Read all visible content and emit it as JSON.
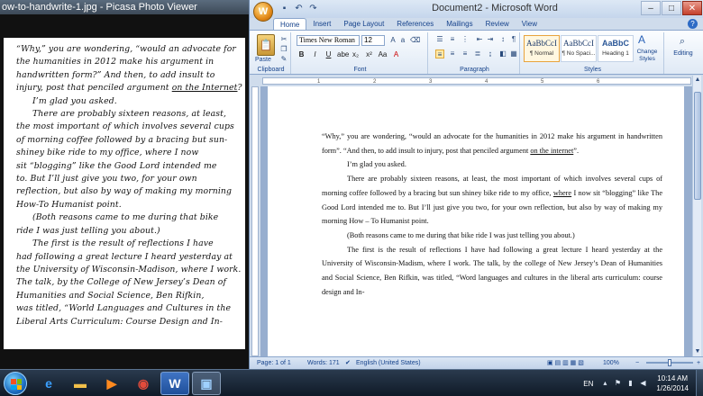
{
  "picasa": {
    "title": "ow-to-handwrite-1.jpg - Picasa Photo Viewer",
    "handwriting": [
      {
        "text": "“Why,” you are wondering, “would an advocate for",
        "indent": false
      },
      {
        "text": "the humanities in 2012 make his argument in",
        "indent": false
      },
      {
        "text": "handwritten form?” And then, to add insult to",
        "indent": false
      },
      {
        "text": "injury, post that penciled argument on the Internet?",
        "indent": false,
        "underline": "on the Internet"
      },
      {
        "text": "I’m glad you asked.",
        "indent": true
      },
      {
        "text": "There are probably sixteen reasons, at least,",
        "indent": true
      },
      {
        "text": "the most important of which involves several cups",
        "indent": false
      },
      {
        "text": "of morning coffee followed by a bracing but sun-",
        "indent": false
      },
      {
        "text": "shiney bike ride to my office, where I now",
        "indent": false
      },
      {
        "text": "sit “blogging” like the Good Lord intended me",
        "indent": false
      },
      {
        "text": "to. But I’ll just give you two, for your own",
        "indent": false
      },
      {
        "text": "reflection, but also by way of making my morning",
        "indent": false
      },
      {
        "text": "How-To Humanist point.",
        "indent": false
      },
      {
        "text": "(Both reasons came to me during that bike",
        "indent": true
      },
      {
        "text": "ride I was just telling you about.)",
        "indent": false
      },
      {
        "text": "The first is the result of reflections I have",
        "indent": true
      },
      {
        "text": "had following a great lecture I heard yesterday at",
        "indent": false
      },
      {
        "text": "the University of Wisconsin-Madison, where I work.",
        "indent": false
      },
      {
        "text": "The talk, by the College of New Jersey’s Dean of",
        "indent": false
      },
      {
        "text": "Humanities and Social Science, Ben Rifkin,",
        "indent": false
      },
      {
        "text": "was titled, “World Languages and Cultures in the",
        "indent": false
      },
      {
        "text": "Liberal Arts Curriculum: Course Design and In-",
        "indent": false
      }
    ]
  },
  "word": {
    "title": "Document2 - Microsoft Word",
    "office_button": "W",
    "window_controls": [
      "–",
      "□",
      "✕"
    ],
    "qat_icons": [
      "save-icon",
      "undo-icon",
      "redo-icon"
    ],
    "tabs": [
      "Home",
      "Insert",
      "Page Layout",
      "References",
      "Mailings",
      "Review",
      "View"
    ],
    "active_tab": "Home",
    "ribbon": {
      "clipboard": {
        "label": "Clipboard",
        "paste": "Paste"
      },
      "font": {
        "label": "Font",
        "family": "Times New Roman",
        "size": "12",
        "buttons": [
          "B",
          "I",
          "U",
          "abe",
          "x₂",
          "x²",
          "Aa",
          "A"
        ]
      },
      "paragraph": {
        "label": "Paragraph"
      },
      "styles": {
        "label": "Styles",
        "items": [
          {
            "sample": "AaBbCcI",
            "name": "¶ Normal",
            "selected": true
          },
          {
            "sample": "AaBbCcI",
            "name": "¶ No Spaci...",
            "selected": false
          },
          {
            "sample": "AaBbC",
            "name": "Heading 1",
            "selected": false
          }
        ],
        "change_styles": "Change Styles"
      },
      "editing": {
        "label": "Editing"
      }
    },
    "ruler_marks": [
      "1",
      "2",
      "3",
      "4",
      "5",
      "6"
    ],
    "document": {
      "paragraphs": [
        {
          "indent": false,
          "parts": [
            {
              "t": "“Why,” you are wondering, “would an advocate for the humanities in 2012 make his argument in handwritten form”. “And then, to add insult to injury, post that penciled argument "
            },
            {
              "t": "on the internet",
              "u": true
            },
            {
              "t": "”."
            }
          ]
        },
        {
          "indent": true,
          "parts": [
            {
              "t": "I’m glad you asked."
            }
          ]
        },
        {
          "indent": true,
          "parts": [
            {
              "t": "There are probably sixteen reasons, at least, the most important of which involves several cups of morning coffee followed by a bracing but sun shiney bike ride to my office, "
            },
            {
              "t": "where",
              "u": true
            },
            {
              "t": " I now sit “blogging” like The Good Lord intended me to. But I’ll just give you two, for your own reflection, but also by way of making my morning How – To Humanist point."
            }
          ]
        },
        {
          "indent": true,
          "parts": [
            {
              "t": "(Both reasons came to me during that bike ride I was just telling you about.)"
            }
          ]
        },
        {
          "indent": true,
          "parts": [
            {
              "t": "The first is the result of reflections I have had following a great lecture I heard yesterday at the University of Wisconsin-Madism, where I work. The talk, by the college of New Jersey’s Dean of Humanities and Social Science, Ben Rifkin, was titled, “Word languages and cultures in the liberal arts curriculum: course design and In-"
            }
          ]
        }
      ]
    },
    "status": {
      "page": "Page: 1 of 1",
      "words": "Words: 171",
      "language": "English (United States)",
      "zoom": "100%",
      "zoom_level": 1.0
    }
  },
  "taskbar": {
    "apps": [
      {
        "name": "internet-explorer",
        "glyph": "e",
        "color": "#3ba0ff"
      },
      {
        "name": "file-explorer",
        "glyph": "▬",
        "color": "#f2c04a"
      },
      {
        "name": "media-player",
        "glyph": "▶",
        "color": "#ff8a1f"
      },
      {
        "name": "chrome",
        "glyph": "◉",
        "color": "#e24b3b"
      },
      {
        "name": "word",
        "glyph": "W",
        "color": "#ffffff",
        "active": true
      },
      {
        "name": "picasa-viewer",
        "glyph": "▣",
        "color": "#9fd0ff",
        "active": true
      }
    ],
    "language": "EN",
    "time": "10:14 AM",
    "date": "1/26/2014"
  }
}
